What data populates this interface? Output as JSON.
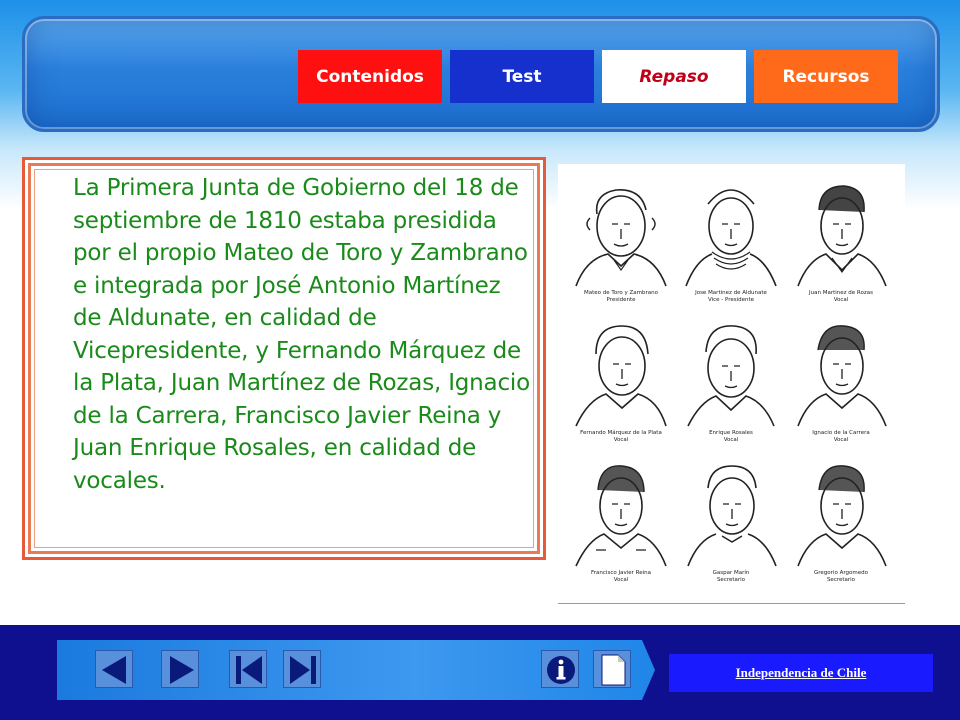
{
  "tabs": [
    {
      "label": "Contenidos"
    },
    {
      "label": "Test"
    },
    {
      "label": "Repaso"
    },
    {
      "label": "Recursos"
    }
  ],
  "body_text": "La Primera Junta de Gobierno del 18 de septiembre de 1810 estaba presidida por el propio Mateo de Toro y Zambrano e integrada por José Antonio Martínez de Aldunate, en calidad de Vicepresidente, y Fernando Márquez de la Plata, Juan Martínez de Rozas, Ignacio de la Carrera, Francisco Javier Reina y Juan Enrique Rosales, en calidad de vocales.",
  "portraits": [
    {
      "name": "Mateo de Toro y Zambrano",
      "role": "Presidente"
    },
    {
      "name": "Jose Martinez de Aldunate",
      "role": "Vice - Presidente"
    },
    {
      "name": "Juan Martinez de Rozas",
      "role": "Vocal"
    },
    {
      "name": "Fernando Márquez de la Plata",
      "role": "Vocal"
    },
    {
      "name": "Enrique Rosales",
      "role": "Vocal"
    },
    {
      "name": "Ignacio de la Carrera",
      "role": "Vocal"
    },
    {
      "name": "Francisco Javier Reina",
      "role": "Vocal"
    },
    {
      "name": "Gaspar Marín",
      "role": "Secretario"
    },
    {
      "name": "Gregorio Argomedo",
      "role": "Secretario"
    }
  ],
  "footer": {
    "title": "Independencia de Chile",
    "buttons": [
      {
        "icon": "previous-icon"
      },
      {
        "icon": "next-icon"
      },
      {
        "icon": "first-icon"
      },
      {
        "icon": "last-icon"
      },
      {
        "icon": "info-icon"
      },
      {
        "icon": "page-icon"
      }
    ]
  },
  "colors": {
    "tab_contenidos": "#ff1010",
    "tab_test": "#1530cc",
    "tab_repaso": "#ffffff",
    "tab_recursos": "#ff6a1a",
    "body_text": "#1a8a1a",
    "footer": "#0f1090"
  }
}
